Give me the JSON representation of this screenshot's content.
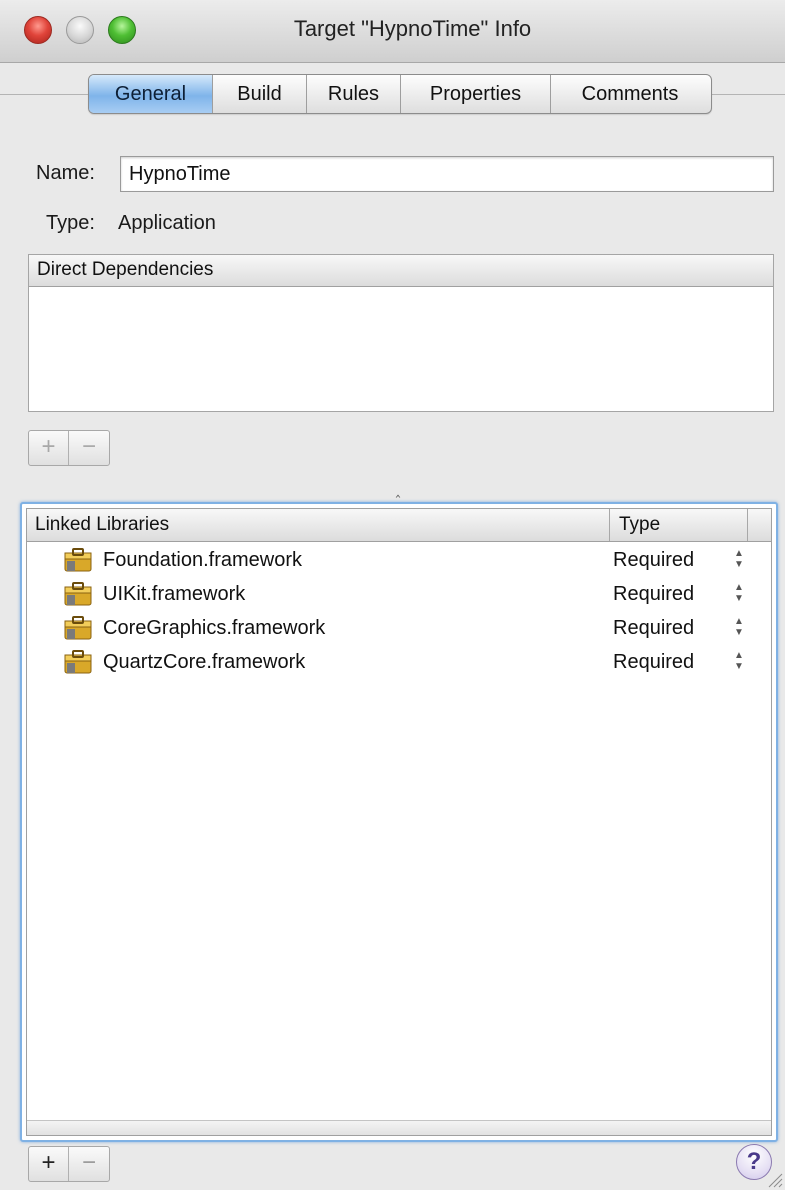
{
  "window": {
    "title": "Target \"HypnoTime\" Info"
  },
  "tabs": [
    {
      "label": "General",
      "active": true
    },
    {
      "label": "Build",
      "active": false
    },
    {
      "label": "Rules",
      "active": false
    },
    {
      "label": "Properties",
      "active": false
    },
    {
      "label": "Comments",
      "active": false
    }
  ],
  "general": {
    "name_label": "Name:",
    "name_value": "HypnoTime",
    "type_label": "Type:",
    "type_value": "Application",
    "dependencies_header": "Direct Dependencies",
    "deps_add": "+",
    "deps_remove": "−"
  },
  "linked_libraries": {
    "col_name": "Linked Libraries",
    "col_type": "Type",
    "rows": [
      {
        "name": "Foundation.framework",
        "type": "Required"
      },
      {
        "name": "UIKit.framework",
        "type": "Required"
      },
      {
        "name": "CoreGraphics.framework",
        "type": "Required"
      },
      {
        "name": "QuartzCore.framework",
        "type": "Required"
      }
    ],
    "add": "+",
    "remove": "−"
  },
  "help": "?",
  "icons": {
    "framework": "toolbox-framework-icon",
    "help": "help-icon"
  }
}
